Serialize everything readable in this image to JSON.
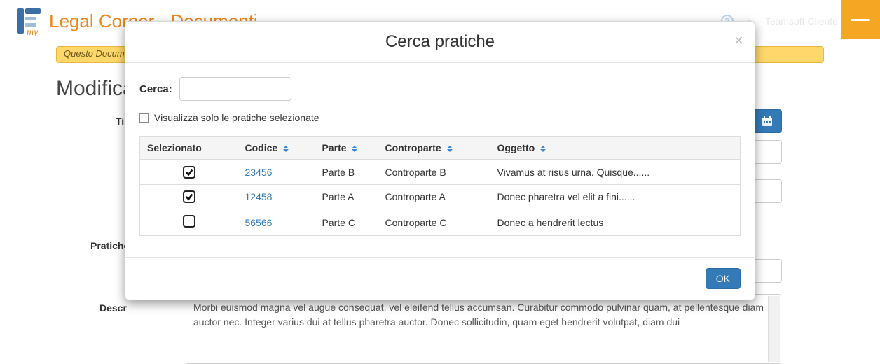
{
  "app": {
    "title": "Legal Corner - Documenti",
    "user": "Teamsoft Cliente"
  },
  "page": {
    "alert": "Questo Docum",
    "heading": "Modifica",
    "label_ti": "Ti",
    "label_pratiche": "Pratiche",
    "label_descr": "Descr",
    "description": "Morbi euismod magna vel augue consequat, vel eleifend tellus accumsan. Curabitur commodo pulvinar quam, at pellentesque diam auctor nec. Integer varius dui at tellus pharetra auctor. Donec sollicitudin, quam eget hendrerit volutpat, diam dui"
  },
  "modal": {
    "title": "Cerca pratiche",
    "search_label": "Cerca:",
    "search_value": "",
    "filter_label": "Visualizza solo le pratiche selezionate",
    "ok_label": "OK",
    "columns": {
      "selezionato": "Selezionato",
      "codice": "Codice",
      "parte": "Parte",
      "controparte": "Controparte",
      "oggetto": "Oggetto"
    },
    "rows": [
      {
        "selected": true,
        "codice": "23456",
        "parte": "Parte B",
        "controparte": "Controparte B",
        "oggetto": "Vivamus at risus urna. Quisque......"
      },
      {
        "selected": true,
        "codice": "12458",
        "parte": "Parte A",
        "controparte": "Controparte A",
        "oggetto": "Donec pharetra vel elit a fini......"
      },
      {
        "selected": false,
        "codice": "56566",
        "parte": "Parte C",
        "controparte": "Controparte C",
        "oggetto": "Donec a hendrerit lectus"
      }
    ]
  }
}
